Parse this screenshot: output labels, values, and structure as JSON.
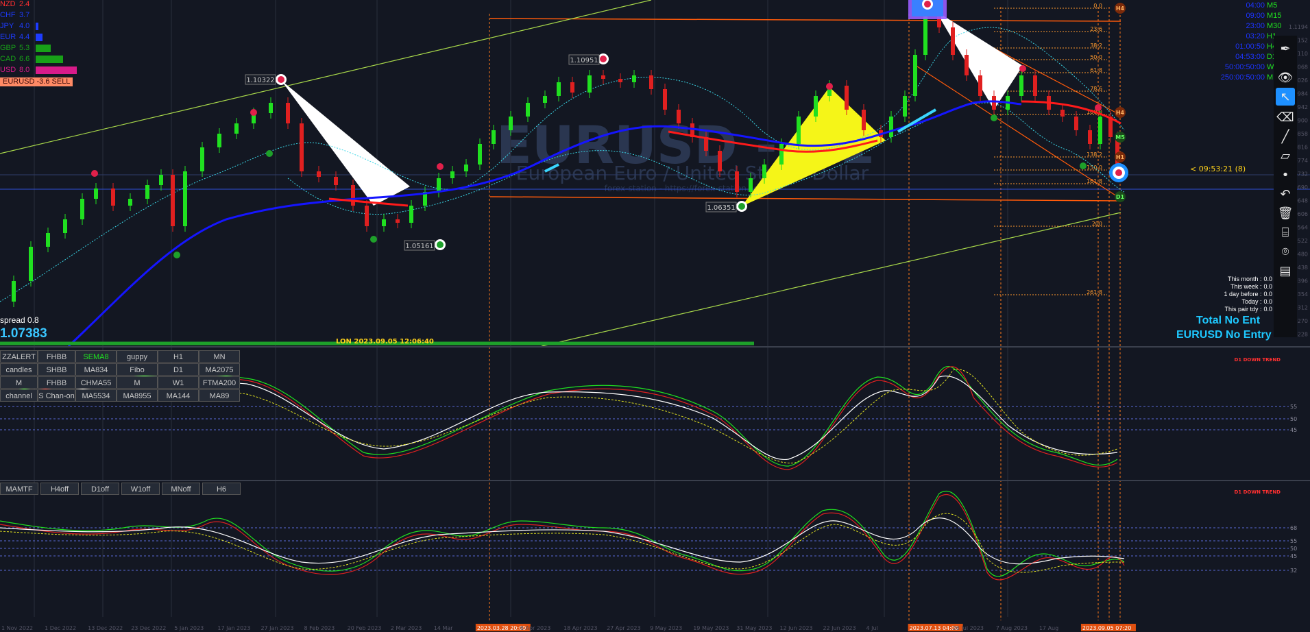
{
  "instrument": {
    "watermark": "EURUSD - D1",
    "subtitle": "European Euro / United States Dollar",
    "site": "forex-station - https://forex-station.com"
  },
  "strength_panel": [
    {
      "label": "NZD",
      "value": "2.4",
      "color": "#ff3030"
    },
    {
      "label": "CHF",
      "value": "3.7",
      "color": "#1e3cff"
    },
    {
      "label": "JPY",
      "value": "4.0",
      "color": "#1e3cff"
    },
    {
      "label": "EUR",
      "value": "4.4",
      "color": "#1e3cff"
    },
    {
      "label": "GBP",
      "value": "5.3",
      "color": "#18a018"
    },
    {
      "label": "CAD",
      "value": "6.6",
      "color": "#18a018"
    },
    {
      "label": "USD",
      "value": "8.0",
      "color": "#d81b8a"
    }
  ],
  "signal_badge": "EURUSD -3.6 SELL",
  "spread": "spread 0.8",
  "bid": "1.07383",
  "session_label": "LON 2023.09.05 12:06:40",
  "timer": "< 09:53:21 (8)",
  "price_labels": {
    "p1": "1.10322",
    "p2": "1.10951",
    "p3": "1.06351",
    "p4": "1.05161"
  },
  "fib_levels": [
    "0.0",
    "23.6",
    "38.2",
    "50.0",
    "61.8",
    "78.6",
    "100.0",
    "138.2",
    "150.0",
    "161.8",
    "200",
    "261.8"
  ],
  "tf_badges": [
    "H4",
    "M5",
    "H1",
    "D1"
  ],
  "mtf_table": [
    {
      "tf": "M5",
      "time": "04:00"
    },
    {
      "tf": "M15",
      "time": "09:00"
    },
    {
      "tf": "M30",
      "time": "23:00"
    },
    {
      "tf": "H1",
      "time": "03:20"
    },
    {
      "tf": "H4",
      "time": "01:00:50"
    },
    {
      "tf": "D1",
      "time": "04:53:00"
    },
    {
      "tf": "W1",
      "time": "50:00:50:00"
    },
    {
      "tf": "MN",
      "time": "250:00:50:00"
    }
  ],
  "stats": [
    {
      "label": "This month :",
      "value": "0.0"
    },
    {
      "label": "This week :",
      "value": "0.0"
    },
    {
      "label": "1 day before :",
      "value": "0.0"
    },
    {
      "label": "Today :",
      "value": "0.0"
    },
    {
      "label": "This pair tdy :",
      "value": "0.0"
    }
  ],
  "total_no_entry": "Total No Ent",
  "pair_no_entry": "EURUSD No Entry",
  "trend_label_1": "D1 DOWN TREND",
  "trend_label_2": "D1 DOWN TREND",
  "button_grid": [
    [
      "ZZALERT",
      "FHBB",
      "SEMA8",
      "guppy",
      "H1",
      "MN"
    ],
    [
      "candles",
      "SHBB",
      "MA834",
      "Fibo",
      "D1",
      "MA2075"
    ],
    [
      "M",
      "FHBB",
      "CHMA55",
      "M",
      "W1",
      "FTMA200"
    ],
    [
      "channel",
      "S Chan-on",
      "MA5534",
      "MA8955",
      "MA144",
      "MA89"
    ]
  ],
  "mamtf_buttons": [
    "MAMTF",
    "H4off",
    "D1off",
    "W1off",
    "MNoff",
    "H6"
  ],
  "date_axis": [
    "1 Nov 2022",
    "1 Dec 2022",
    "13 Dec 2022",
    "23 Dec 2022",
    "5 Jan 2023",
    "17 Jan 2023",
    "27 Jan 2023",
    "8 Feb 2023",
    "20 Feb 2023",
    "2 Mar 2023",
    "14 Mar",
    "2023.03.28 20:00",
    "6 Apr 2023",
    "18 Apr 2023",
    "27 Apr 2023",
    "9 May 2023",
    "19 May 2023",
    "31 May 2023",
    "12 Jun 2023",
    "22 Jun 2023",
    "4 Jul",
    "2023.07.13 04:00",
    "26 Jul 2023",
    "7 Aug 2023",
    "17 Aug",
    "2023.09.05 07:20"
  ],
  "price_axis": [
    "1.1194",
    "1.1152",
    "1.1110",
    "1.1068",
    "1.1026",
    "1.0984",
    "1.0942",
    "1.0900",
    "1.0858",
    "1.0816",
    "1.0774",
    "1.0732",
    "1.0690",
    "1.0648",
    "1.0606",
    "1.0564",
    "1.0522",
    "1.0480",
    "1.0438",
    "1.0396",
    "1.0354",
    "1.0312",
    "1.0270",
    "1.0228"
  ],
  "osc_levels_1": [
    "55",
    "50",
    "45"
  ],
  "osc_levels_2": [
    "68",
    "55",
    "50",
    "45",
    "32"
  ],
  "colors": {
    "bg": "#131722",
    "bull": "#20e020",
    "bear": "#e02020",
    "ma_blue": "#1515ff",
    "ma_red": "#ff1a1a",
    "fib": "#ff9a2e",
    "channel": "#a8d84a",
    "accent": "#1e90ff"
  }
}
